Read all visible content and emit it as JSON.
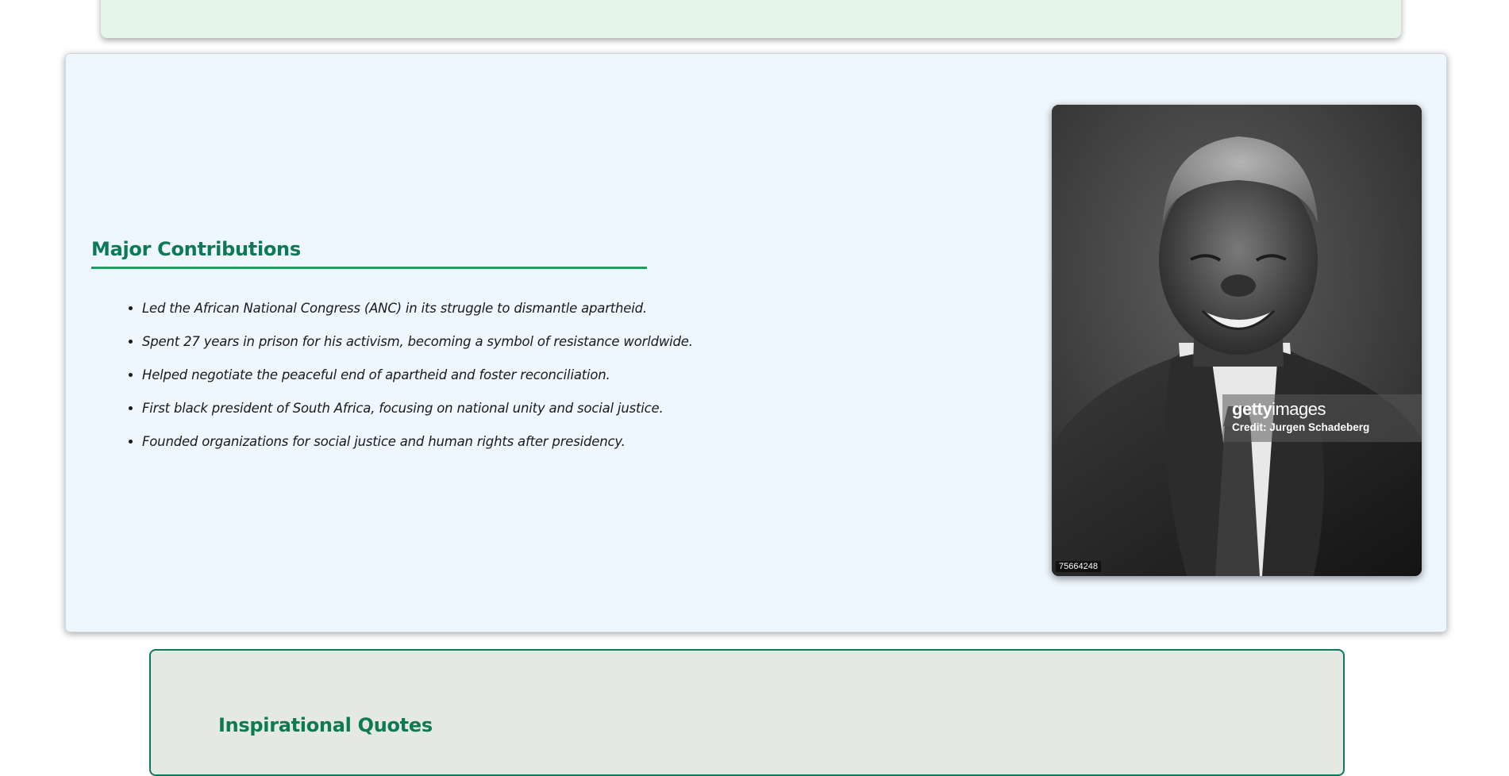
{
  "contributions": {
    "title": "Major Contributions",
    "items": [
      "Led the African National Congress (ANC) in its struggle to dismantle apartheid.",
      "Spent 27 years in prison for his activism, becoming a symbol of resistance worldwide.",
      "Helped negotiate the peaceful end of apartheid and foster reconciliation.",
      "First black president of South Africa, focusing on national unity and social justice.",
      "Founded organizations for social justice and human rights after presidency."
    ],
    "photo": {
      "watermark_brand_bold": "getty",
      "watermark_brand_light": "images",
      "credit": "Credit: Jurgen Schadeberg",
      "image_id": "75664248"
    }
  },
  "quotes": {
    "title": "Inspirational Quotes"
  },
  "colors": {
    "heading": "#0b7a55",
    "accent_rule": "#1f9e63",
    "contrib_bg": "#eef6fe",
    "top_card_bg": "#e6f5e9",
    "quotes_bg": "#e6e8e3",
    "quotes_border": "#0f7a5a"
  }
}
